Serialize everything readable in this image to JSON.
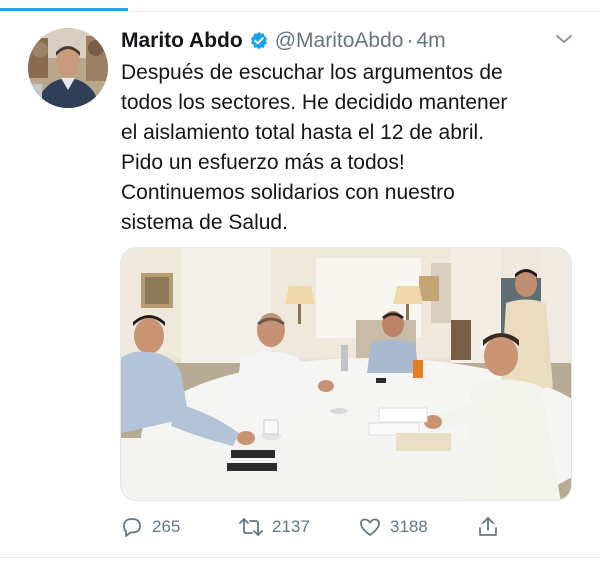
{
  "tweet": {
    "author_name": "Marito Abdo",
    "handle": "@MaritoAbdo",
    "separator": "·",
    "time": "4m",
    "text": "Después de escuchar los argumentos de\ntodos los sectores. He decidido mantener\nel aislamiento total hasta el 12 de abril.\nPido un esfuerzo más a todos!\nContinuemos solidarios con nuestro\nsistema de Salud.",
    "verified": true
  },
  "actions": {
    "replies": "265",
    "retweets": "2137",
    "likes": "3188"
  },
  "colors": {
    "accent": "#1da1f2",
    "secondary_text": "#657786",
    "primary_text": "#14171a"
  },
  "icons": [
    "verified-badge-icon",
    "chevron-down-icon",
    "reply-icon",
    "retweet-icon",
    "like-icon",
    "share-icon"
  ]
}
